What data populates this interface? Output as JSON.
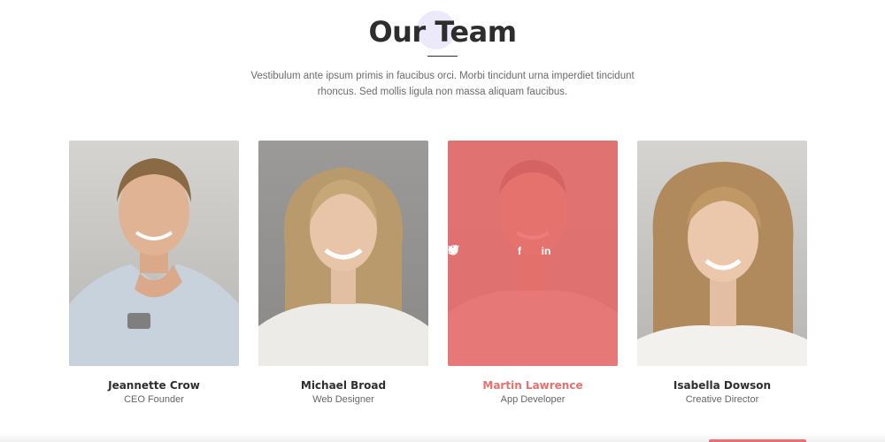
{
  "section": {
    "title": "Our Team",
    "intro": "Vestibulum ante ipsum primis in faucibus orci. Morbi tincidunt urna imperdiet tincidunt rhoncus. Sed mollis ligula non massa aliquam faucibus."
  },
  "members": [
    {
      "name": "Jeannette Crow",
      "role": "CEO Founder"
    },
    {
      "name": "Michael Broad",
      "role": "Web Designer"
    },
    {
      "name": "Martin Lawrence",
      "role": "App Developer"
    },
    {
      "name": "Isabella Dowson",
      "role": "Creative Director"
    }
  ],
  "social_icons": [
    "twitter-icon",
    "facebook-icon",
    "linkedin-icon",
    "dribbble-icon"
  ],
  "social_labels": {
    "facebook": "f",
    "linkedin": "in"
  },
  "colors": {
    "accent": "#e77070",
    "title": "#2d2d2d",
    "text": "#6b6b6b",
    "overlay": "#e86868",
    "title_deco": "#ece9fb"
  }
}
